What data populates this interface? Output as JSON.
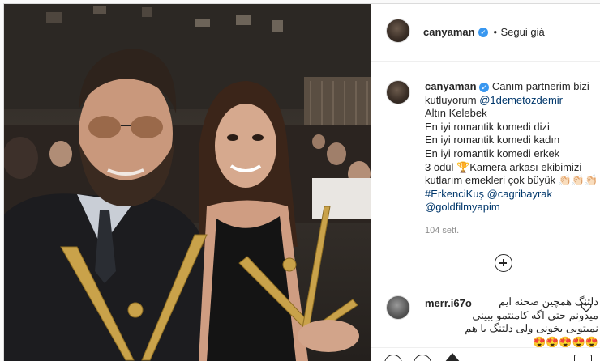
{
  "post": {
    "username": "canyaman",
    "follow_status": "Segui già",
    "caption": {
      "intro": "Canım partnerim bizi",
      "line2_text": "kutluyorum",
      "mention": "@1demetozdemir",
      "lines": [
        "Altın Kelebek",
        "En iyi romantik komedi dizi",
        "En iyi romantik komedi kadın",
        "En iyi romantik komedi erkek"
      ],
      "award_line": "3 ödül 🏆Kamera arkası ekibimizi",
      "closing": "kutlarım emekleri çok büyük 👏🏻👏🏻👏🏻",
      "hashtag": "#ErkenciKuş",
      "tag1": "@cagribayrak",
      "tag2": "@goldfilmyapim"
    },
    "time": "104 sett."
  },
  "comment": {
    "username": "merr.i67o",
    "line1": "دلتنگ همچین صحنه ایم",
    "line2": "میدونم حتی اگه کامنتمو ببینی",
    "line3": "نمیتونی بخونی ولی دلتنگ با هم",
    "line4": "😍😍😍😍😍"
  },
  "icons": {
    "verified": "verified-badge-icon",
    "plus": "load-more-comments-icon"
  }
}
